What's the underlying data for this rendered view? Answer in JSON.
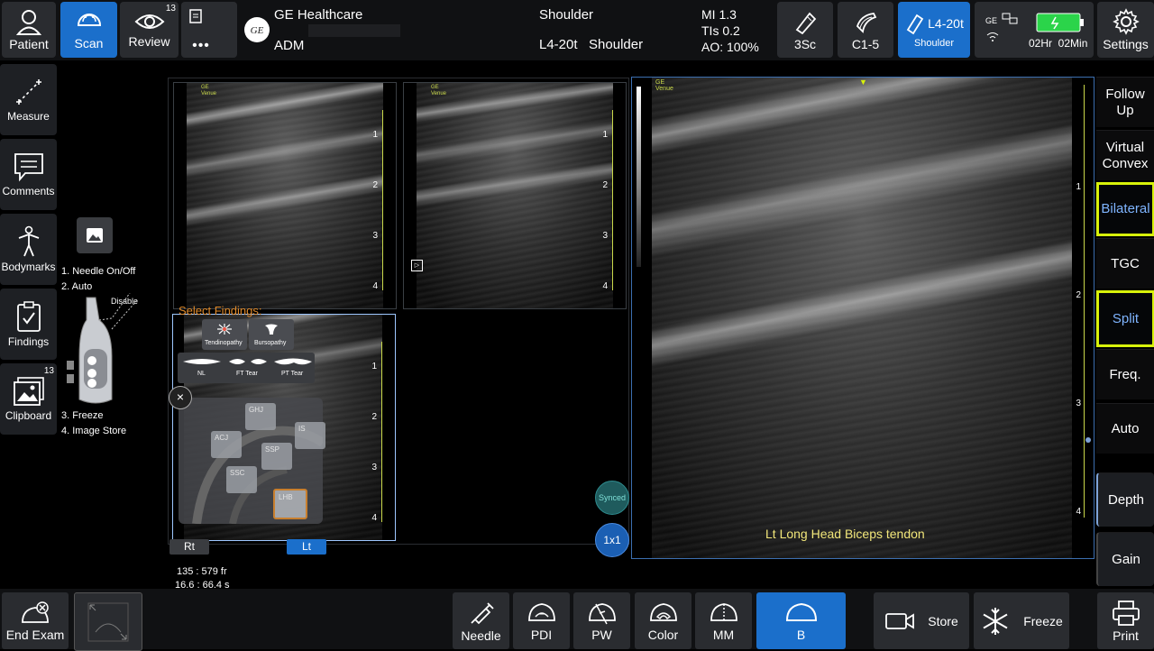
{
  "topbar": {
    "patient": "Patient",
    "scan": "Scan",
    "review": "Review",
    "review_count": "13",
    "more": "•••",
    "brand": "GE Healthcare",
    "operator": "ADM",
    "exam": "Shoulder",
    "probe_preset": "L4-20t   Shoulder",
    "mi": "MI 1.3",
    "tis": "TIs 0.2",
    "ao": "AO: 100%",
    "probe1": "3Sc",
    "probe2": "C1-5",
    "probe3": "L4-20t",
    "probe3_sub": "Shoulder",
    "battery_time": "02Hr  02Min",
    "battery_brand": "GE",
    "settings": "Settings"
  },
  "left_tools": {
    "measure": "Measure",
    "comments": "Comments",
    "bodymarks": "Bodymarks",
    "findings": "Findings",
    "clipboard": "Clipboard",
    "clipboard_count": "13"
  },
  "probe_help": {
    "line1": "1. Needle On/Off",
    "line2": "2. Auto",
    "disable": "Disable",
    "line3": "3. Freeze",
    "line4": "4. Image Store"
  },
  "images": {
    "depth_marks": [
      "1",
      "2",
      "3",
      "4"
    ],
    "large_depth_marks": [
      "1",
      "2",
      "3",
      "4"
    ],
    "ge_logo": "GE",
    "ge_venue": "Venue",
    "select_findings": "Select Findings:",
    "categories": [
      {
        "label": "Tendinopathy"
      },
      {
        "label": "Bursopathy"
      }
    ],
    "severity": [
      {
        "label": "NL"
      },
      {
        "label": "FT Tear"
      },
      {
        "label": "PT Tear"
      }
    ],
    "regions": [
      {
        "label": "GHJ"
      },
      {
        "label": "IS"
      },
      {
        "label": "ACJ"
      },
      {
        "label": "SSP"
      },
      {
        "label": "SSC"
      },
      {
        "label": "LHB"
      }
    ],
    "rt": "Rt",
    "lt": "Lt",
    "synced": "Synced",
    "layout": "1x1",
    "large_caption": "Lt Long Head Biceps tendon",
    "frame_counter": "135 : 579 fr",
    "time_counter": "16.6 : 66.4 s"
  },
  "right_panel": {
    "follow_up": "Follow Up",
    "virtual_convex": "Virtual Convex",
    "bilateral": "Bilateral",
    "tgc": "TGC",
    "split": "Split",
    "freq": "Freq.",
    "auto": "Auto",
    "depth": "Depth",
    "gain": "Gain"
  },
  "bottombar": {
    "end_exam": "End Exam",
    "needle": "Needle",
    "pdi": "PDI",
    "pw": "PW",
    "color": "Color",
    "mm": "MM",
    "b": "B",
    "store": "Store",
    "freeze": "Freeze",
    "print": "Print"
  },
  "colors": {
    "accent": "#1b6fcb",
    "highlight": "#d8f20a",
    "scale": "#c9d84a",
    "findings_text": "#e08a2a"
  }
}
